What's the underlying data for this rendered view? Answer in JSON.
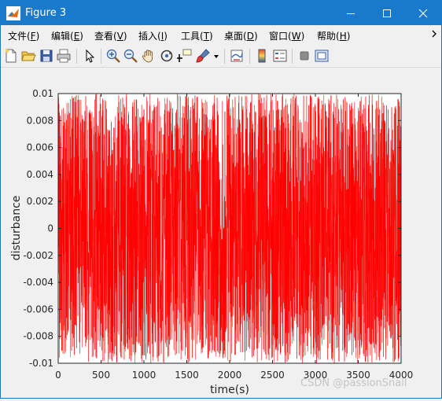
{
  "window": {
    "title": "Figure 3",
    "accent_color": "#1979ca",
    "controls": [
      "minimize-icon",
      "maximize-icon",
      "close-icon"
    ]
  },
  "menu": {
    "items": [
      {
        "label": "文件",
        "accel": "F"
      },
      {
        "label": "编辑",
        "accel": "E"
      },
      {
        "label": "查看",
        "accel": "V"
      },
      {
        "label": "插入",
        "accel": "I"
      },
      {
        "label": "工具",
        "accel": "T"
      },
      {
        "label": "桌面",
        "accel": "D"
      },
      {
        "label": "窗口",
        "accel": "W"
      },
      {
        "label": "帮助",
        "accel": "H"
      }
    ],
    "overflow_icon": "chevron-right-icon"
  },
  "toolbar": {
    "icons": [
      "new-figure-icon",
      "open-file-icon",
      "save-icon",
      "print-icon",
      "edit-plot-icon",
      "zoom-in-icon",
      "zoom-out-icon",
      "pan-icon",
      "rotate-3d-icon",
      "data-cursor-icon",
      "brush-icon",
      "brush-dropdown-icon",
      "link-plot-icon",
      "insert-colorbar-icon",
      "insert-legend-icon",
      "hide-plot-tools-icon",
      "show-plot-tools-icon"
    ]
  },
  "chart_data": {
    "type": "line",
    "xlabel": "time(s)",
    "ylabel": "disturbance",
    "xlim": [
      0,
      4000
    ],
    "ylim": [
      -0.01,
      0.01
    ],
    "xticks": [
      "0",
      "500",
      "1000",
      "1500",
      "2000",
      "2500",
      "3000",
      "3500",
      "4000"
    ],
    "yticks": [
      "0.01",
      "0.008",
      "0.006",
      "0.004",
      "0.002",
      "0",
      "-0.002",
      "-0.004",
      "-0.006",
      "-0.008",
      "-0.01"
    ],
    "grid": false,
    "series": [
      {
        "color": "#ff0000",
        "description_values": "uniform random noise in [-0.01, 0.01], one sample per second",
        "n_points": 4001
      }
    ]
  },
  "watermark": {
    "text": "CSDN @passionSnail"
  }
}
